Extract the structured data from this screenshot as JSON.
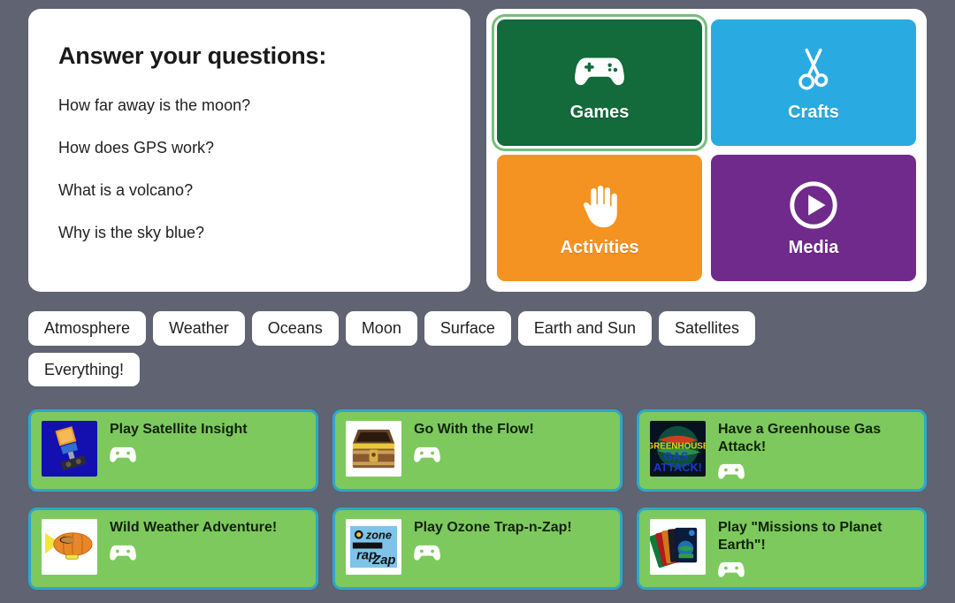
{
  "theme": {
    "page_bg": "#5f6372",
    "panel_bg": "#ffffff",
    "card_bg": "#7dc95e",
    "card_border": "#2ca8c9",
    "selected_ring": "#76bd7d"
  },
  "questions": {
    "title": "Answer your questions:",
    "items": [
      "How far away is the moon?",
      "How does GPS work?",
      "What is a volcano?",
      "Why is the sky blue?"
    ]
  },
  "tiles": [
    {
      "label": "Games",
      "icon": "gamepad-icon",
      "color": "#136a3a",
      "selected": true
    },
    {
      "label": "Crafts",
      "icon": "scissors-icon",
      "color": "#29abe2",
      "selected": false
    },
    {
      "label": "Activities",
      "icon": "hand-icon",
      "color": "#f59322",
      "selected": false
    },
    {
      "label": "Media",
      "icon": "play-circle-icon",
      "color": "#702a8c",
      "selected": false
    }
  ],
  "filters": [
    "Atmosphere",
    "Weather",
    "Oceans",
    "Moon",
    "Surface",
    "Earth and Sun",
    "Satellites",
    "Everything!"
  ],
  "cards": [
    {
      "title": "Play Satellite Insight",
      "thumb": "satellite-thumb",
      "badge": "gamepad-icon"
    },
    {
      "title": "Go With the Flow!",
      "thumb": "chest-thumb",
      "badge": "gamepad-icon"
    },
    {
      "title": "Have a Greenhouse Gas Attack!",
      "thumb": "greenhouse-thumb",
      "badge": "gamepad-icon"
    },
    {
      "title": "Wild Weather Adventure!",
      "thumb": "blimp-thumb",
      "badge": "gamepad-icon"
    },
    {
      "title": "Play Ozone Trap-n-Zap!",
      "thumb": "ozone-thumb",
      "badge": "gamepad-icon"
    },
    {
      "title": "Play \"Missions to Planet Earth\"!",
      "thumb": "missions-thumb",
      "badge": "gamepad-icon"
    }
  ]
}
